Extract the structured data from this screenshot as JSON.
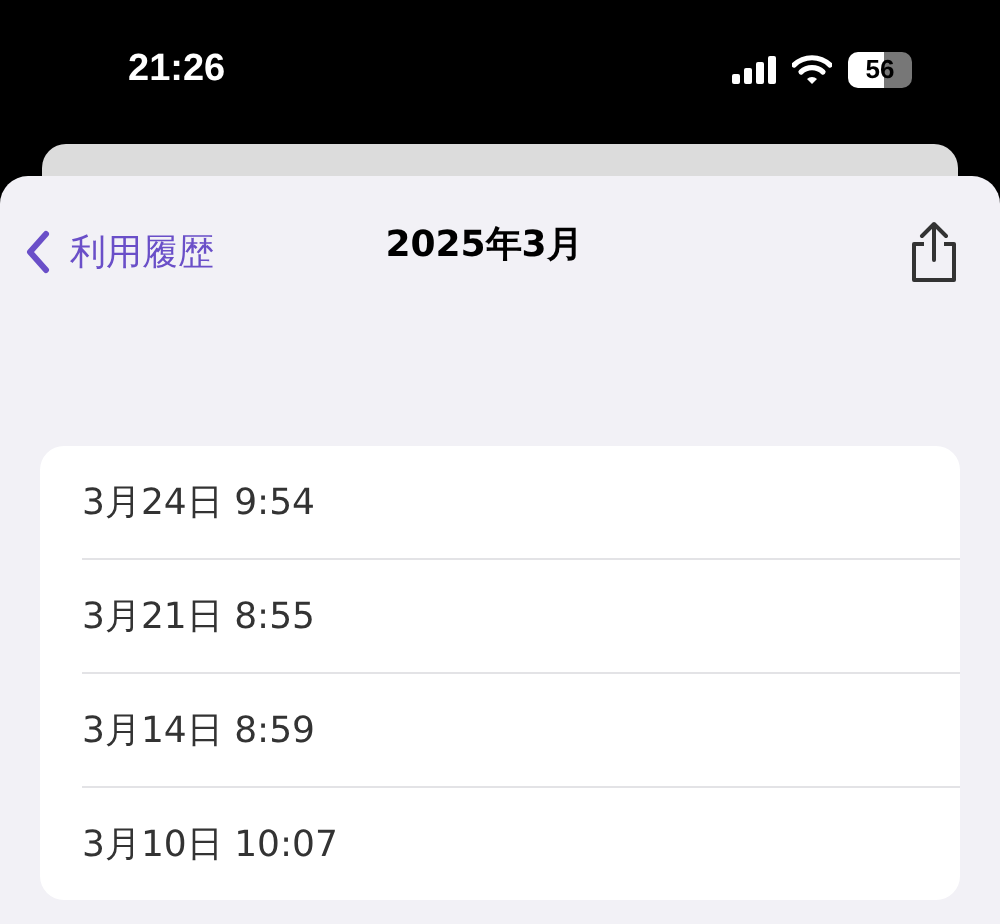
{
  "status_bar": {
    "time": "21:26",
    "battery": "56"
  },
  "nav": {
    "back": "利用履歴",
    "title": "2025年3月"
  },
  "entries": [
    {
      "label": "3月24日 9:54"
    },
    {
      "label": "3月21日 8:55"
    },
    {
      "label": "3月14日 8:59"
    },
    {
      "label": "3月10日 10:07"
    }
  ]
}
